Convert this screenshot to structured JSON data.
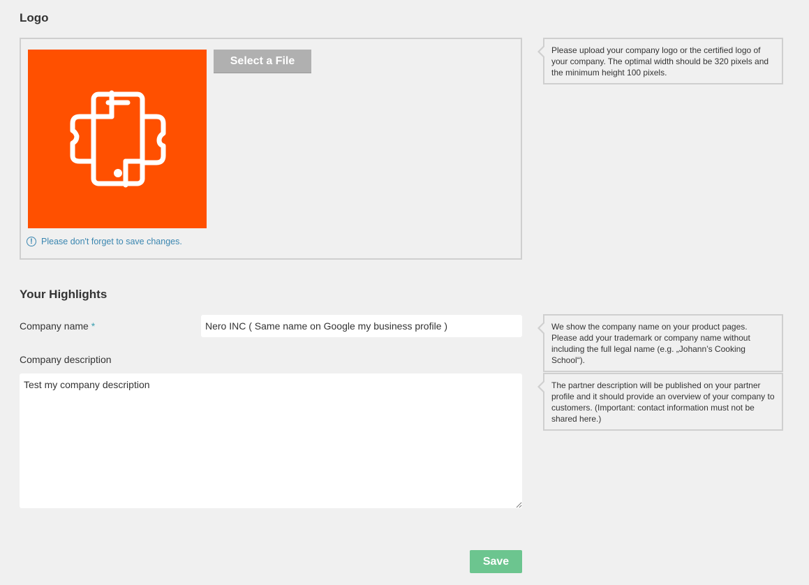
{
  "logo_section": {
    "heading": "Logo",
    "select_file_label": "Select a File",
    "save_reminder": "Please don't forget to save changes.",
    "hint": "Please upload your company logo or the certified logo of your company. The optimal width should be 320 pixels and the minimum height 100 pixels.",
    "logo_bg_color": "#ff5000",
    "logo_icon": "rotate-device-icon"
  },
  "highlights_section": {
    "heading": "Your Highlights",
    "company_name": {
      "label": "Company name",
      "required_marker": "*",
      "value": "Nero INC ( Same name on Google my business profile )",
      "hint": "We show the company name on your product pages. Please add your trademark or company name without including the full legal name (e.g. „Johann’s Cooking School“)."
    },
    "company_description": {
      "label": "Company description",
      "value": "Test my company description",
      "hint": "The partner description will be published on your partner profile and it should provide an overview of your company to customers. (Important: contact information must not be shared here.)"
    }
  },
  "actions": {
    "save_label": "Save",
    "save_color": "#6cc58f"
  }
}
